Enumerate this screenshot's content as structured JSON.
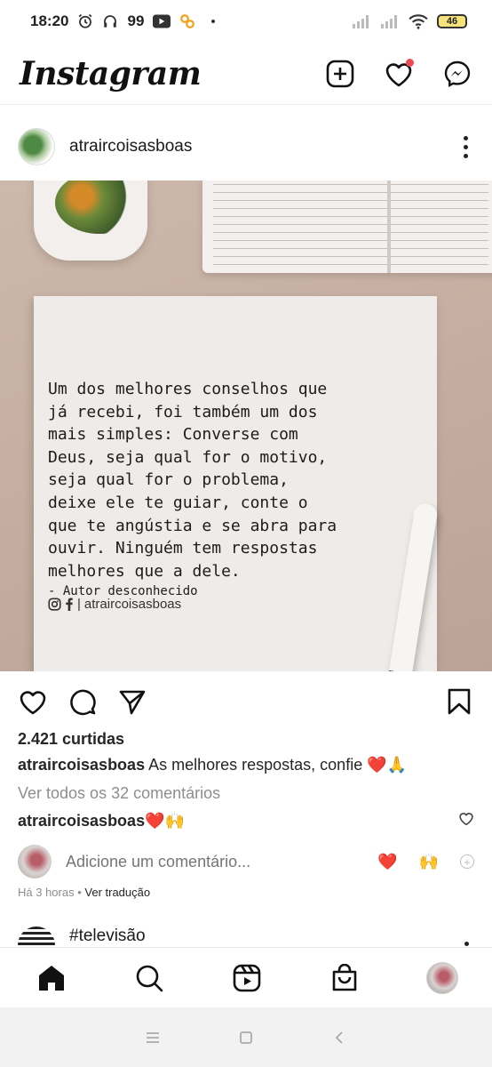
{
  "status_bar": {
    "time": "18:20",
    "notification_count": "99",
    "battery": "46"
  },
  "header": {
    "logo": "Instagram"
  },
  "post": {
    "username": "atraircoisasboas",
    "image": {
      "quote": "Um dos melhores conselhos que\njá recebi, foi também um dos\nmais simples: Converse com\nDeus, seja qual for o motivo,\nseja qual for o problema,\ndeixe ele te guiar, conte o\nque te angústia e se abra para\nouvir. Ninguém tem respostas\nmelhores que a dele.",
      "author": "- Autor desconhecido",
      "handle": "atraircoisasboas"
    },
    "likes": "2.421 curtidas",
    "caption": {
      "username": "atraircoisasboas",
      "text": "As melhores respostas, confie ❤️🙏"
    },
    "view_comments": "Ver todos os 32 comentários",
    "comment": {
      "username": "atraircoisasboas",
      "text": "❤️🙌"
    },
    "add_comment_placeholder": "Adicione um comentário...",
    "quick_emojis": [
      "❤️",
      "🙌"
    ],
    "timestamp": "Há 3 horas",
    "translate": "Ver tradução"
  },
  "next_post": {
    "username": "#televisão"
  },
  "colors": {
    "notification_dot": "#ed4956",
    "like_red": "#e0245e",
    "secondary_text": "#8e8e8e"
  }
}
